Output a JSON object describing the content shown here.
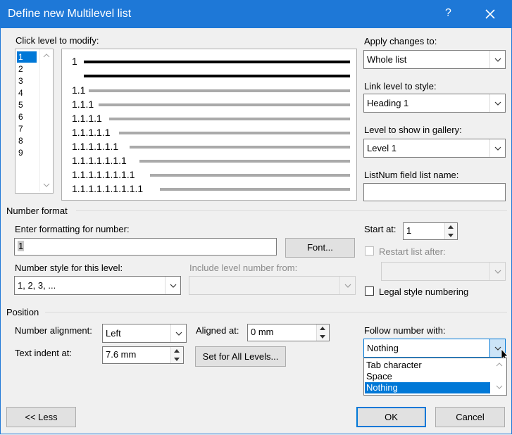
{
  "window": {
    "title": "Define new Multilevel list",
    "help": "?",
    "close_icon": "close-icon"
  },
  "levels": {
    "label": "Click level to modify:",
    "items": [
      "1",
      "2",
      "3",
      "4",
      "5",
      "6",
      "7",
      "8",
      "9"
    ],
    "selected": "1"
  },
  "preview": {
    "numbers": [
      "1",
      "1.1",
      "1.1.1",
      "1.1.1.1",
      "1.1.1.1.1",
      "1.1.1.1.1.1",
      "1.1.1.1.1.1.1",
      "1.1.1.1.1.1.1.1",
      "1.1.1.1.1.1.1.1.1"
    ]
  },
  "apply": {
    "label": "Apply changes to:",
    "value": "Whole list"
  },
  "link_style": {
    "label": "Link level to style:",
    "value": "Heading 1"
  },
  "gallery": {
    "label": "Level to show in gallery:",
    "value": "Level 1"
  },
  "listnum": {
    "label": "ListNum field list name:",
    "value": ""
  },
  "number_format": {
    "section": "Number format",
    "enter_label": "Enter formatting for number:",
    "format_value": "1",
    "font_button": "Font...",
    "style_label": "Number style for this level:",
    "style_value": "1, 2, 3, ...",
    "include_label": "Include level number from:",
    "include_value": "",
    "start_label": "Start at:",
    "start_value": "1",
    "restart_label": "Restart list after:",
    "restart_value": "",
    "legal_label": "Legal style numbering"
  },
  "position": {
    "section": "Position",
    "alignment_label": "Number alignment:",
    "alignment_value": "Left",
    "aligned_at_label": "Aligned at:",
    "aligned_at_value": "0 mm",
    "indent_label": "Text indent at:",
    "indent_value": "7.6 mm",
    "set_all_button": "Set for All Levels...",
    "follow_label": "Follow number with:",
    "follow_value": "Nothing",
    "follow_options": [
      "Tab character",
      "Space",
      "Nothing"
    ]
  },
  "footer": {
    "less_button": "<< Less",
    "ok_button": "OK",
    "cancel_button": "Cancel"
  }
}
